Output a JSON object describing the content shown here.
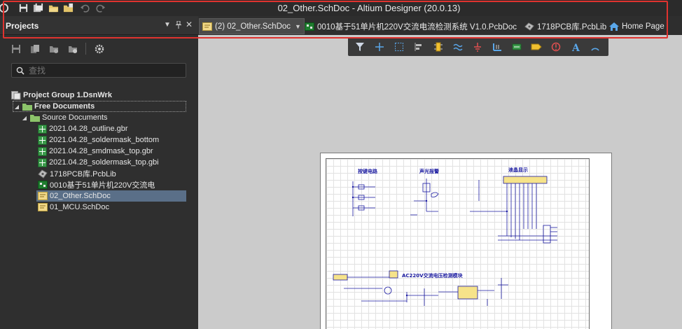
{
  "window": {
    "title": "02_Other.SchDoc - Altium Designer (20.0.13)"
  },
  "quick_access": {
    "icons": [
      "app-icon",
      "save-icon",
      "save-all-icon",
      "open-icon",
      "open-project-icon",
      "undo-icon",
      "redo-icon"
    ]
  },
  "panel": {
    "title": "Projects",
    "menu_icon": "dropdown-icon",
    "pin_icon": "pin-icon",
    "close_icon": "close-icon",
    "search_placeholder": "查找"
  },
  "tabs": [
    {
      "label": "(2) 02_Other.SchDoc",
      "icon": "schematic-icon",
      "active": true
    },
    {
      "label": "0010基于51单片机220V交流电流检测系统 V1.0.PcbDoc",
      "icon": "pcb-icon",
      "active": false
    },
    {
      "label": "1718PCB库.PcbLib",
      "icon": "pcblib-icon",
      "active": false
    },
    {
      "label": "Home Page",
      "icon": "home-icon",
      "active": false
    }
  ],
  "tree": {
    "project_group": "Project Group 1.DsnWrk",
    "free_documents": "Free Documents",
    "source_documents": "Source Documents",
    "files": [
      {
        "label": "2021.04.28_outline.gbr",
        "icon": "gerber-icon"
      },
      {
        "label": "2021.04.28_soldermask_bottom",
        "icon": "gerber-icon"
      },
      {
        "label": "2021.04.28_smdmask_top.gbr",
        "icon": "gerber-icon"
      },
      {
        "label": "2021.04.28_soldermask_top.gbi",
        "icon": "gerber-icon"
      },
      {
        "label": "1718PCB库.PcbLib",
        "icon": "pcblib-icon"
      },
      {
        "label": "0010基于51单片机220V交流电",
        "icon": "pcb-icon"
      },
      {
        "label": "02_Other.SchDoc",
        "icon": "schematic-icon",
        "selected": true
      },
      {
        "label": "01_MCU.SchDoc",
        "icon": "schematic-icon"
      }
    ]
  },
  "active_bar": {
    "tools": [
      "filter-icon",
      "move-icon",
      "select-icon",
      "align-icon",
      "part-icon",
      "wire-icon",
      "power-port-icon",
      "bus-icon",
      "harness-icon",
      "port-icon",
      "directive-icon",
      "text-icon",
      "arc-icon"
    ]
  },
  "schematic": {
    "sections": [
      "按键电路",
      "声光报警",
      "液晶显示",
      "AC220V交流电压检测模块"
    ]
  }
}
